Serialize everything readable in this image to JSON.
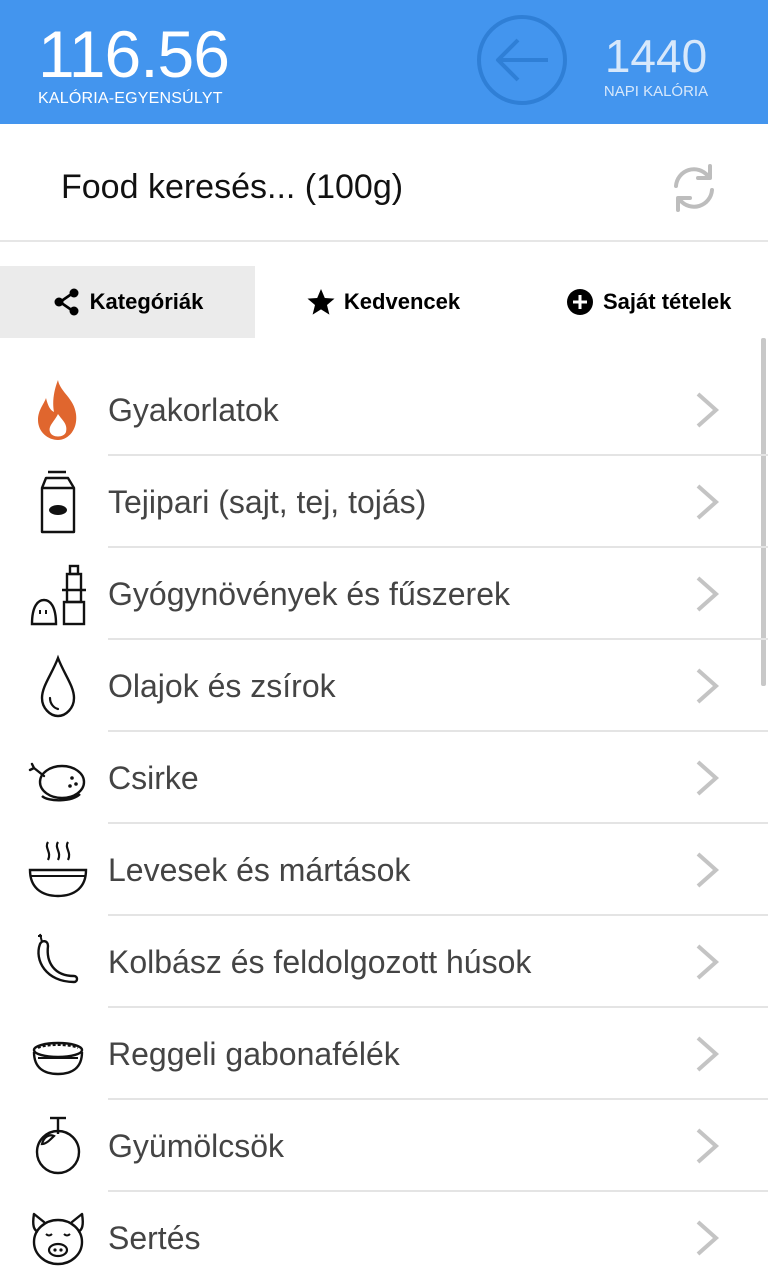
{
  "header": {
    "balance_value": "116.56",
    "balance_label": "KALÓRIA-EGYENSÚLYT",
    "daily_value": "1440",
    "daily_label": "NAPI KALÓRIA",
    "accent_color": "#4395ee"
  },
  "search": {
    "text": "Food keresés... (100g)"
  },
  "tabs": [
    {
      "label": "Kategóriák",
      "icon": "share-icon",
      "active": true
    },
    {
      "label": "Kedvencek",
      "icon": "star-icon",
      "active": false
    },
    {
      "label": "Saját tételek",
      "icon": "plus-circle-icon",
      "active": false
    }
  ],
  "categories": [
    {
      "label": "Gyakorlatok",
      "icon": "flame-icon"
    },
    {
      "label": "Tejipari (sajt, tej, tojás)",
      "icon": "milk-carton-icon"
    },
    {
      "label": "Gyógynövények és fűszerek",
      "icon": "spice-grinder-icon"
    },
    {
      "label": "Olajok és zsírok",
      "icon": "oil-drop-icon"
    },
    {
      "label": "Csirke",
      "icon": "chicken-icon"
    },
    {
      "label": "Levesek és mártások",
      "icon": "soup-bowl-icon"
    },
    {
      "label": "Kolbász és feldolgozott húsok",
      "icon": "sausage-icon"
    },
    {
      "label": "Reggeli gabonafélék",
      "icon": "cereal-bowl-icon"
    },
    {
      "label": "Gyümölcsök",
      "icon": "fruit-icon"
    },
    {
      "label": "Sertés",
      "icon": "pig-icon"
    }
  ]
}
